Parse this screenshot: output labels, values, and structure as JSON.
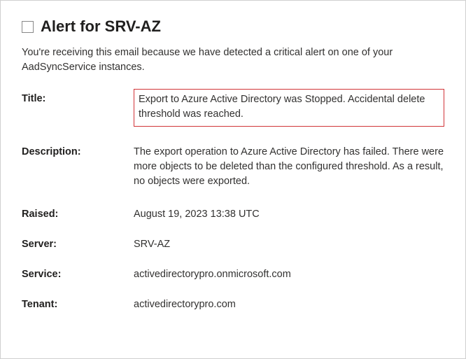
{
  "header": {
    "title": "Alert for SRV-AZ"
  },
  "intro": "You're receiving this email because we have detected a critical alert on one of your AadSyncService instances.",
  "fields": {
    "title_label": "Title:",
    "title_value": "Export to Azure Active Directory was Stopped. Accidental delete threshold was reached.",
    "description_label": "Description:",
    "description_value": "The export operation to Azure Active Directory has failed. There were more objects to be deleted than the configured threshold. As a result, no objects were exported.",
    "raised_label": "Raised:",
    "raised_value": "August 19, 2023 13:38 UTC",
    "server_label": "Server:",
    "server_value": "SRV-AZ",
    "service_label": "Service:",
    "service_value": "activedirectorypro.onmicrosoft.com",
    "tenant_label": "Tenant:",
    "tenant_value": "activedirectorypro.com"
  }
}
